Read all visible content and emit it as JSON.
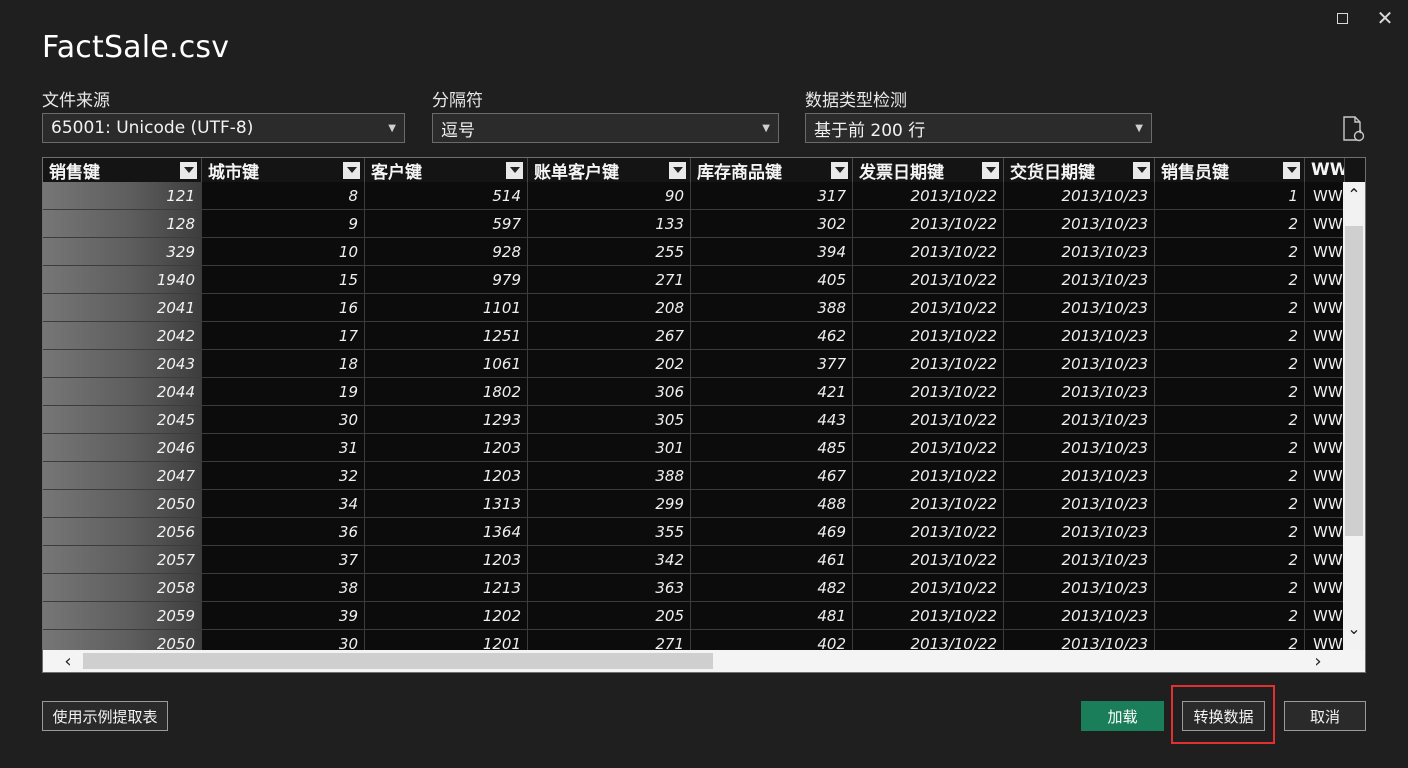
{
  "window": {
    "title": "FactSale.csv",
    "maximize_icon": "maximize-icon",
    "close_icon": "close-icon",
    "close_glyph": "✕"
  },
  "file_origin": {
    "label": "文件来源",
    "value": "65001: Unicode (UTF-8)"
  },
  "delimiter": {
    "label": "分隔符",
    "value": "逗号"
  },
  "type_detection": {
    "label": "数据类型检测",
    "value": "基于前 200 行"
  },
  "table": {
    "columns": [
      "销售键",
      "城市键",
      "客户键",
      "账单客户键",
      "库存商品键",
      "发票日期键",
      "交货日期键",
      "销售员键",
      "WWI..."
    ],
    "rows": [
      [
        "121",
        "8",
        "514",
        "90",
        "317",
        "2013/10/22",
        "2013/10/23",
        "1",
        "WWI"
      ],
      [
        "128",
        "9",
        "597",
        "133",
        "302",
        "2013/10/22",
        "2013/10/23",
        "2",
        "WWI"
      ],
      [
        "329",
        "10",
        "928",
        "255",
        "394",
        "2013/10/22",
        "2013/10/23",
        "2",
        "WWI"
      ],
      [
        "1940",
        "15",
        "979",
        "271",
        "405",
        "2013/10/22",
        "2013/10/23",
        "2",
        "WWI"
      ],
      [
        "2041",
        "16",
        "1101",
        "208",
        "388",
        "2013/10/22",
        "2013/10/23",
        "2",
        "WWI"
      ],
      [
        "2042",
        "17",
        "1251",
        "267",
        "462",
        "2013/10/22",
        "2013/10/23",
        "2",
        "WWI"
      ],
      [
        "2043",
        "18",
        "1061",
        "202",
        "377",
        "2013/10/22",
        "2013/10/23",
        "2",
        "WWI"
      ],
      [
        "2044",
        "19",
        "1802",
        "306",
        "421",
        "2013/10/22",
        "2013/10/23",
        "2",
        "WWI"
      ],
      [
        "2045",
        "30",
        "1293",
        "305",
        "443",
        "2013/10/22",
        "2013/10/23",
        "2",
        "WWI"
      ],
      [
        "2046",
        "31",
        "1203",
        "301",
        "485",
        "2013/10/22",
        "2013/10/23",
        "2",
        "WWI"
      ],
      [
        "2047",
        "32",
        "1203",
        "388",
        "467",
        "2013/10/22",
        "2013/10/23",
        "2",
        "WWI"
      ],
      [
        "2050",
        "34",
        "1313",
        "299",
        "488",
        "2013/10/22",
        "2013/10/23",
        "2",
        "WWI"
      ],
      [
        "2056",
        "36",
        "1364",
        "355",
        "469",
        "2013/10/22",
        "2013/10/23",
        "2",
        "WWI"
      ],
      [
        "2057",
        "37",
        "1203",
        "342",
        "461",
        "2013/10/22",
        "2013/10/23",
        "2",
        "WWI"
      ],
      [
        "2058",
        "38",
        "1213",
        "363",
        "482",
        "2013/10/22",
        "2013/10/23",
        "2",
        "WWI"
      ],
      [
        "2059",
        "39",
        "1202",
        "205",
        "481",
        "2013/10/22",
        "2013/10/23",
        "2",
        "WWI"
      ],
      [
        "2050",
        "30",
        "1201",
        "271",
        "402",
        "2013/10/22",
        "2013/10/23",
        "2",
        "WWI"
      ]
    ]
  },
  "scroll": {
    "up_glyph": "⌃",
    "down_glyph": "⌄",
    "left_glyph": "‹",
    "right_glyph": "›"
  },
  "footer": {
    "extract_example": "使用示例提取表",
    "load": "加载",
    "transform": "转换数据",
    "cancel": "取消"
  },
  "colors": {
    "primary_button": "#1b7e5a",
    "highlight_border": "#e03030",
    "background": "#1f1f1f"
  }
}
